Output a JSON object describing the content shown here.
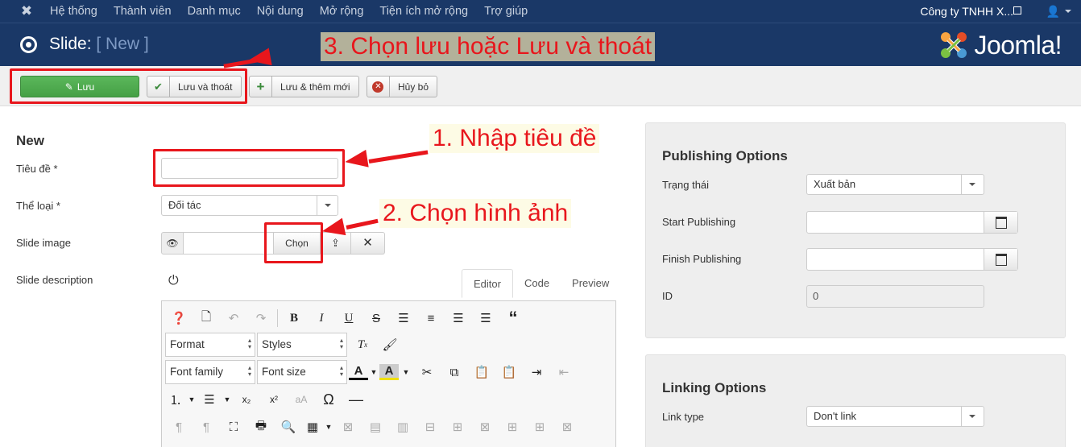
{
  "navbar": {
    "menu": [
      "Hệ thống",
      "Thành viên",
      "Danh mục",
      "Nội dung",
      "Mở rộng",
      "Tiện ích mở rộng",
      "Trợ giúp"
    ],
    "company": "Công ty TNHH X..."
  },
  "header": {
    "title": "Slide:",
    "subtitle": "[ New ]",
    "brand": "Joomla!"
  },
  "toolbar": {
    "save_label": "Lưu",
    "save_close_label": "Lưu và thoát",
    "save_new_label": "Lưu & thêm mới",
    "cancel_label": "Hủy bỏ"
  },
  "annotations": {
    "step1": "1. Nhập tiêu đề",
    "step2": "2. Chọn hình ảnh",
    "step3": "3. Chọn lưu hoặc Lưu và thoát"
  },
  "form": {
    "heading": "New",
    "title_label": "Tiêu đề *",
    "title_value": "",
    "category_label": "Thể loại *",
    "category_value": "Đối tác",
    "image_label": "Slide image",
    "image_value": "",
    "choose_label": "Chọn",
    "description_label": "Slide description"
  },
  "editor": {
    "tabs": [
      "Editor",
      "Code",
      "Preview"
    ],
    "active_tab": "Editor",
    "format_select": "Format",
    "styles_select": "Styles",
    "font_family_select": "Font family",
    "font_size_select": "Font size"
  },
  "publishing": {
    "heading": "Publishing Options",
    "status_label": "Trạng thái",
    "status_value": "Xuất bản",
    "start_label": "Start Publishing",
    "start_value": "",
    "finish_label": "Finish Publishing",
    "finish_value": "",
    "id_label": "ID",
    "id_value": "0"
  },
  "linking": {
    "heading": "Linking Options",
    "link_type_label": "Link type",
    "link_type_value": "Don't link"
  },
  "colors": {
    "nav_bg": "#1a3867",
    "save_green": "#45a045",
    "annotation_red": "#e8161c"
  }
}
